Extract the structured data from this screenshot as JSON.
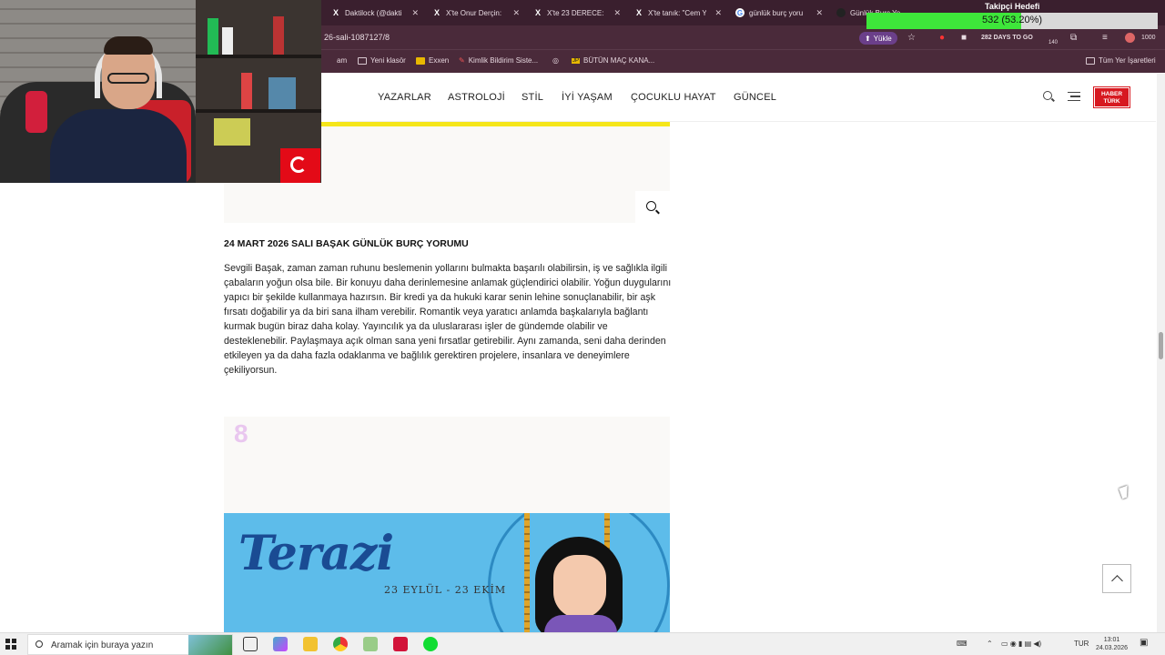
{
  "browser": {
    "tabs": [
      {
        "label": "Daktilock (@dakti",
        "icon": "x-logo-icon"
      },
      {
        "label": "X'te Onur Derçin:",
        "icon": "x-logo-icon"
      },
      {
        "label": "X'te 23 DERECE:",
        "icon": "x-logo-icon"
      },
      {
        "label": "X'te tanık: \"Cem Y",
        "icon": "x-logo-icon"
      },
      {
        "label": "günlük burç yoru",
        "icon": "google-icon"
      },
      {
        "label": "Günlük Burç Yo",
        "icon": "page-icon"
      }
    ],
    "url": "26-sali-1087127/8",
    "upload_label": "Yükle",
    "days_badge": "282 DAYS TO GO",
    "counter": "140",
    "profile_count": "1000",
    "bookmarks": [
      {
        "label": "am",
        "icon": "none"
      },
      {
        "label": "Yeni klasör",
        "icon": "folder-icon"
      },
      {
        "label": "Exxen",
        "icon": "exxen-icon"
      },
      {
        "label": "Kimlik Bildirim Siste...",
        "icon": "pen-icon"
      },
      {
        "label": "",
        "icon": "globe-icon"
      },
      {
        "label": "BÜTÜN MAÇ KANA...",
        "icon": "jp-icon"
      },
      {
        "label": "Tüm Yer İşaretleri",
        "icon": "folder-icon"
      }
    ]
  },
  "overlay": {
    "title": "Takipçi Hedefi",
    "progress_text": "532 (53.20%)",
    "progress_fraction": 0.532,
    "fill_color": "#3ee63a"
  },
  "site": {
    "nav": [
      "YAZARLAR",
      "ASTROLOJİ",
      "STİL",
      "İYİ YAŞAM",
      "ÇOCUKLU HAYAT",
      "GÜNCEL"
    ],
    "logo_line1": "HABER",
    "logo_line2": "TÜRK",
    "accent": "#f5e619",
    "logo_color": "#d71920"
  },
  "article": {
    "heading": "24 MART 2026 SALI BAŞAK GÜNLÜK BURÇ YORUMU",
    "body": "Sevgili Başak, zaman zaman ruhunu beslemenin yollarını bulmakta başarılı olabilirsin, iş ve sağlıkla ilgili çabaların yoğun olsa bile. Bir konuyu daha derinlemesine anlamak güçlendirici olabilir. Yoğun duygularını yapıcı bir şekilde kullanmaya hazırsın. Bir kredi ya da hukuki karar senin lehine sonuçlanabilir, bir aşk fırsatı doğabilir ya da biri sana ilham verebilir. Romantik veya yaratıcı anlamda başkalarıyla bağlantı kurmak bugün biraz daha kolay. Yayıncılık ya da uluslararası işler de gündemde olabilir ve desteklenebilir. Paylaşmaya açık olman sana yeni fırsatlar getirebilir. Aynı zamanda, seni daha derinden etkileyen ya da daha fazla odaklanma ve bağlılık gerektiren projelere, insanlara ve deneyimlere çekiliyorsun.",
    "next_number": "8",
    "banner_title": "Terazi",
    "banner_dates": "23 EYLÜL - 23 EKİM"
  },
  "taskbar": {
    "search_placeholder": "Aramak için buraya yazın",
    "lang": "TUR",
    "time": "13:01",
    "date": "24.03.2026"
  }
}
